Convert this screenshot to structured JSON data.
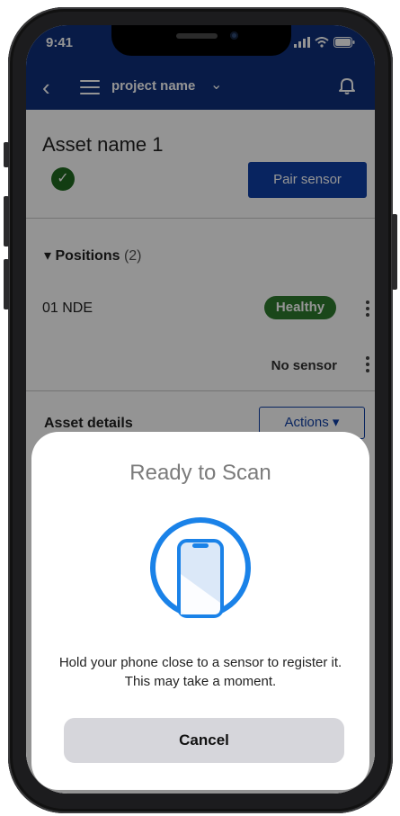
{
  "status_bar": {
    "time": "9:41"
  },
  "nav": {
    "title": "project name",
    "back_icon": "chevron-left-icon",
    "menu_icon": "hamburger-icon",
    "bell_icon": "bell-icon"
  },
  "asset": {
    "name": "Asset name 1",
    "pair_label": "Pair sensor"
  },
  "positions": {
    "label": "Positions",
    "count": "(2)",
    "items": [
      {
        "name": "01 NDE",
        "status": "Healthy"
      },
      {
        "name": "",
        "status": "No sensor"
      }
    ]
  },
  "details": {
    "title": "Asset details",
    "actions_label": "Actions ▾"
  },
  "scan_sheet": {
    "title": "Ready to Scan",
    "message": "Hold your phone close to a sensor to register it. This may take a moment.",
    "cancel_label": "Cancel",
    "accent": "#1a82e8"
  },
  "colors": {
    "brand": "#0e2f7a",
    "button": "#0e3fa6",
    "healthy": "#2e7a2e"
  }
}
